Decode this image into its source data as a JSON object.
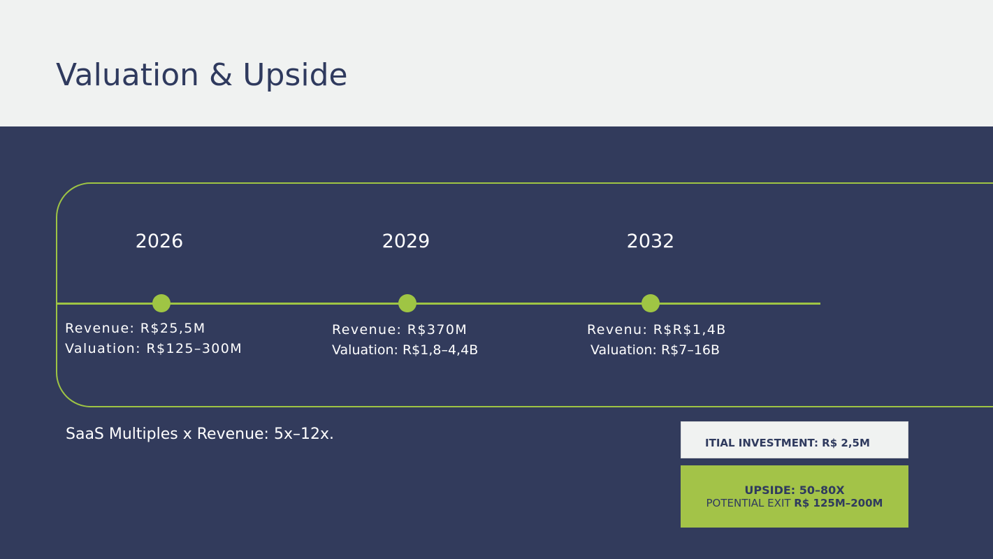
{
  "title": "Valuation & Upside",
  "milestones": [
    {
      "year": "2026",
      "revenue": "Revenue: R$25,5M",
      "valuation": "Valuation: R$125–300M"
    },
    {
      "year": "2029",
      "revenue": "Revenue: R$370M",
      "valuation": "Valuation: R$1,8–4,4B"
    },
    {
      "year": "2032",
      "revenue": "Revenu: R$R$1,4B",
      "valuation": "Valuation: R$7–16B"
    }
  ],
  "note": "SaaS Multiples x Revenue: 5x–12x.",
  "investment": "ITIAL INVESTMENT: R$ 2,5M",
  "upside": {
    "headline": "UPSIDE: 50–80X",
    "exit_label": "POTENTIAL EXIT ",
    "exit_value": "R$ 125M–200M"
  },
  "colors": {
    "background_light": "#f0f2f1",
    "panel_navy": "#323b5c",
    "accent_green": "#9fc544",
    "title_navy": "#2f3a5e"
  }
}
